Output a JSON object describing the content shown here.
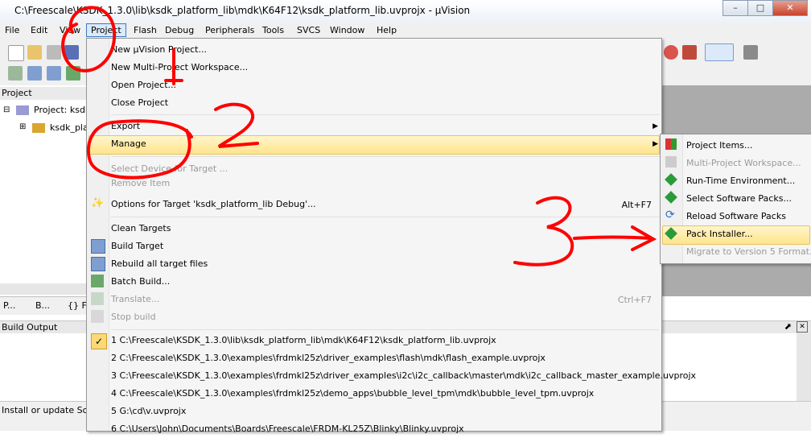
{
  "window": {
    "title": "C:\\Freescale\\KSDK_1.3.0\\lib\\ksdk_platform_lib\\mdk\\K64F12\\ksdk_platform_lib.uvprojx - µVision",
    "minimize": "–",
    "maximize": "□",
    "close": "✕"
  },
  "menubar": {
    "items": [
      "File",
      "Edit",
      "View",
      "Project",
      "Flash",
      "Debug",
      "Peripherals",
      "Tools",
      "SVCS",
      "Window",
      "Help"
    ]
  },
  "project_pane": {
    "header": "Project",
    "root": "Project: ksdk",
    "child": "ksdk_pla"
  },
  "bottom_tabs": [
    "P...",
    "B...",
    "{} F"
  ],
  "build_output": {
    "header": "Build Output"
  },
  "status": {
    "text": "Install or update Sof"
  },
  "project_menu": {
    "items": [
      {
        "label": "New µVision Project...",
        "disabled": false
      },
      {
        "label": "New Multi-Project Workspace...",
        "disabled": false
      },
      {
        "label": "Open Project...",
        "disabled": false
      },
      {
        "label": "Close Project",
        "disabled": false
      },
      {
        "label": "Export",
        "disabled": false
      },
      {
        "label": "Manage",
        "disabled": false
      },
      {
        "label": "Select Device for Target ...",
        "disabled": true
      },
      {
        "label": "Remove Item",
        "disabled": true
      },
      {
        "label": "Options for Target 'ksdk_platform_lib Debug'...",
        "disabled": false,
        "accel": "Alt+F7"
      },
      {
        "label": "Clean Targets",
        "disabled": false
      },
      {
        "label": "Build Target",
        "disabled": false
      },
      {
        "label": "Rebuild all target files",
        "disabled": false
      },
      {
        "label": "Batch Build...",
        "disabled": false
      },
      {
        "label": "Translate...",
        "disabled": true,
        "accel": "Ctrl+F7"
      },
      {
        "label": "Stop build",
        "disabled": true
      }
    ],
    "recent": [
      "1 C:\\Freescale\\KSDK_1.3.0\\lib\\ksdk_platform_lib\\mdk\\K64F12\\ksdk_platform_lib.uvprojx",
      "2 C:\\Freescale\\KSDK_1.3.0\\examples\\frdmkl25z\\driver_examples\\flash\\mdk\\flash_example.uvprojx",
      "3 C:\\Freescale\\KSDK_1.3.0\\examples\\frdmkl25z\\driver_examples\\i2c\\i2c_callback\\master\\mdk\\i2c_callback_master_example.uvprojx",
      "4 C:\\Freescale\\KSDK_1.3.0\\examples\\frdmkl25z\\demo_apps\\bubble_level_tpm\\mdk\\bubble_level_tpm.uvprojx",
      "5 G:\\cd\\v.uvprojx",
      "6 C:\\Users\\John\\Documents\\Boards\\Freescale\\FRDM-KL25Z\\Blinky\\Blinky.uvprojx"
    ]
  },
  "manage_submenu": {
    "items": [
      {
        "label": "Project Items...",
        "disabled": false
      },
      {
        "label": "Multi-Project Workspace...",
        "disabled": true
      },
      {
        "label": "Run-Time Environment...",
        "disabled": false
      },
      {
        "label": "Select Software Packs...",
        "disabled": false
      },
      {
        "label": "Reload Software Packs",
        "disabled": false
      },
      {
        "label": "Pack Installer...",
        "disabled": false
      },
      {
        "label": "Migrate to Version 5 Format...",
        "disabled": true
      }
    ]
  },
  "annotations": {
    "step1": "1",
    "step2": "2",
    "step3": "3"
  },
  "colors": {
    "annotation": "#ff0000",
    "highlight": "#ffe48a",
    "project_menu_border": "#3c78c4"
  }
}
